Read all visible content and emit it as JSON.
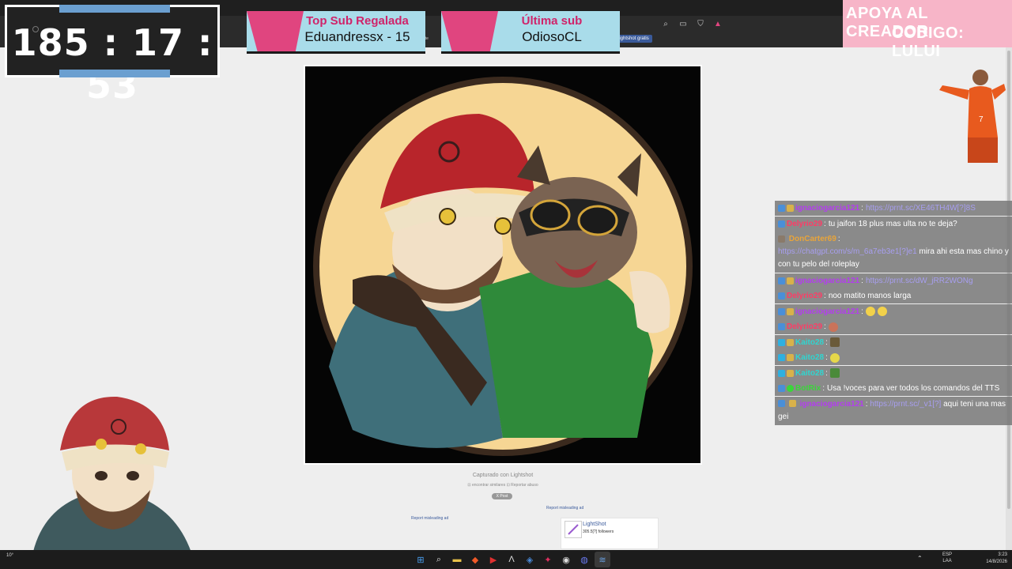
{
  "timer": {
    "display": "185 : 17 : 53"
  },
  "top_sub": {
    "title": "Top Sub Regalada",
    "value": "Eduandressx - 15"
  },
  "last_sub": {
    "title": "Última sub",
    "value": "OdiosoCL"
  },
  "support_banner": {
    "line1": "APOYA AL CREADOR",
    "line2": "CODIGO: LULUI"
  },
  "browser": {
    "promo_label": "Lightshot gratis",
    "tab_hint": "caste"
  },
  "lightshot": {
    "caption": "Capturado con Lightshot",
    "sublinks": "⊡ encontrar similares   ⊡ Reportar abuso",
    "post_button": "X Post",
    "report_misleading_right": "Report misleading ad",
    "report_misleading_left": "Report misleading ad",
    "follow_card": {
      "name": "LightShot",
      "count": "305.5[?] followers"
    }
  },
  "chat": {
    "messages": [
      {
        "user": "ignaciogarcia121",
        "user_color": "#b43cf0",
        "text": "https://prnt.sc/XE46TH4W[?]8S",
        "is_link": true
      },
      {
        "user": "Delyrio29",
        "user_color": "#ff3b66",
        "text": "tu jaifon 18 plus mas ulta no te deja?",
        "is_link": false
      },
      {
        "user": "DonCarter69",
        "user_color": "#e8a43a",
        "text_link": "https://chatgpt.com/s/m_6a7eb3e1[?]e1",
        "text": "mira ahi esta mas chino y con tu pelo del roleplay"
      },
      {
        "user": "ignaciogarcia121",
        "user_color": "#b43cf0",
        "text": "https://prnt.sc/dW_jRR2WONg",
        "is_link": true
      },
      {
        "user": "Delyrio29",
        "user_color": "#ff3b66",
        "text": "noo matito manos larga",
        "is_link": false
      },
      {
        "user": "ignaciogarcia121",
        "user_color": "#b43cf0",
        "text": "",
        "emotes": 2
      },
      {
        "user": "Delyrio29",
        "user_color": "#ff3b66",
        "text": "",
        "emotes": 1
      },
      {
        "user": "Kaito28",
        "user_color": "#2fd6d0",
        "text": "",
        "emotes": 1
      },
      {
        "user": "Kaito28",
        "user_color": "#2fd6d0",
        "text": "",
        "emotes": 1
      },
      {
        "user": "Kaito28",
        "user_color": "#2fd6d0",
        "text": "",
        "emotes": 1
      },
      {
        "user": "BotRix",
        "user_color": "#3ad63a",
        "text": "Usa !voces para ver todos los comandos del TTS",
        "is_link": false
      },
      {
        "user": "ignaciogarcia121",
        "user_color": "#b43cf0",
        "text_link": "https://prnt.sc/_v1[?]",
        "text": "aqui teni una mas gei"
      }
    ]
  },
  "taskbar": {
    "weather": "10°",
    "lang_line1": "ESP",
    "lang_line2": "LAA",
    "time": "3:23",
    "date": "14/8/2026"
  },
  "colors": {
    "sub_panel_bg": "#a9dcea",
    "sub_title": "#d0236a",
    "apoya_bg": "#f7b5c8",
    "timer_accent": "#6b9fd0"
  }
}
